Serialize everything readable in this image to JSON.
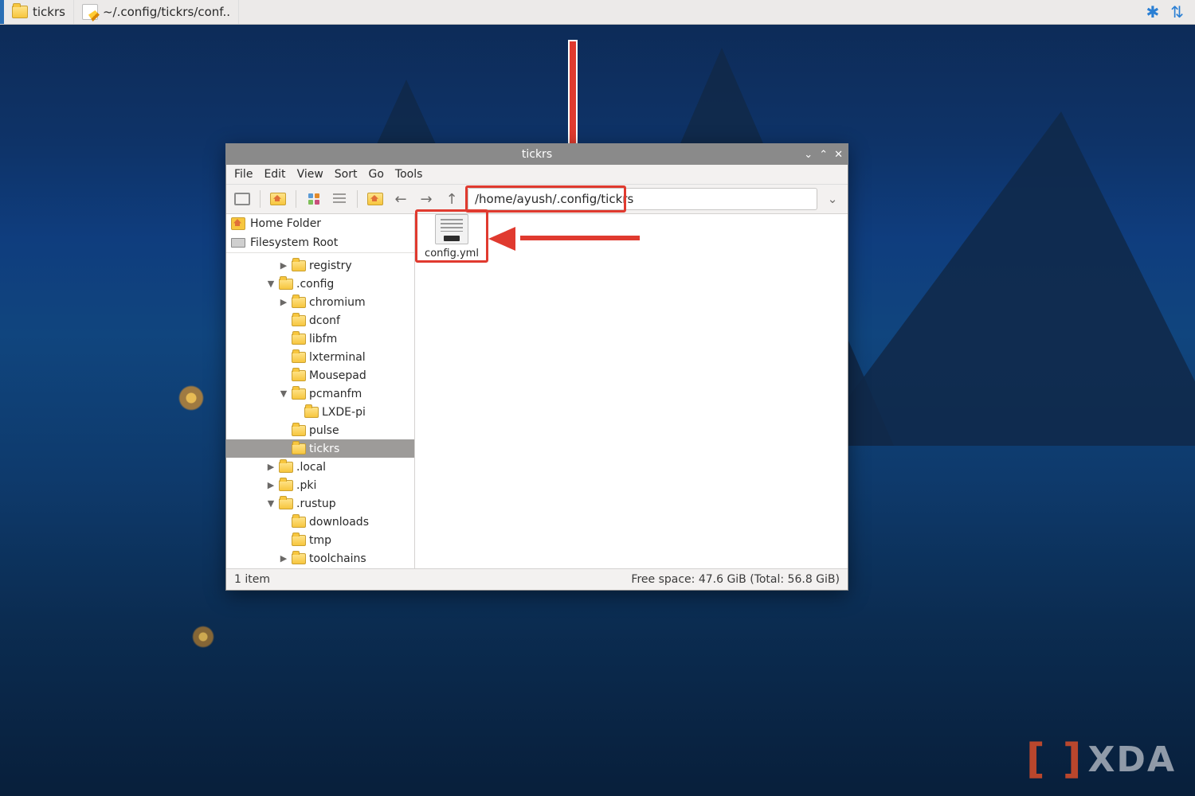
{
  "taskbar": {
    "items": [
      {
        "label": "tickrs"
      },
      {
        "label": "~/.config/tickrs/conf.."
      }
    ],
    "tray": {
      "bluetooth": "bluetooth-icon",
      "network": "network-sync-icon"
    }
  },
  "window": {
    "title": "tickrs",
    "menu": [
      "File",
      "Edit",
      "View",
      "Sort",
      "Go",
      "Tools"
    ],
    "path": "/home/ayush/.config/tickrs",
    "places": [
      {
        "label": "Home Folder"
      },
      {
        "label": "Filesystem Root"
      }
    ],
    "tree": [
      {
        "depth": 3,
        "exp": "▶",
        "label": "registry"
      },
      {
        "depth": 2,
        "exp": "▼",
        "label": ".config"
      },
      {
        "depth": 3,
        "exp": "▶",
        "label": "chromium"
      },
      {
        "depth": 3,
        "exp": "",
        "label": "dconf"
      },
      {
        "depth": 3,
        "exp": "",
        "label": "libfm"
      },
      {
        "depth": 3,
        "exp": "",
        "label": "lxterminal"
      },
      {
        "depth": 3,
        "exp": "",
        "label": "Mousepad"
      },
      {
        "depth": 3,
        "exp": "▼",
        "label": "pcmanfm"
      },
      {
        "depth": 4,
        "exp": "",
        "label": "LXDE-pi"
      },
      {
        "depth": 3,
        "exp": "",
        "label": "pulse"
      },
      {
        "depth": 3,
        "exp": "",
        "label": "tickrs",
        "selected": true
      },
      {
        "depth": 2,
        "exp": "▶",
        "label": ".local"
      },
      {
        "depth": 2,
        "exp": "▶",
        "label": ".pki"
      },
      {
        "depth": 2,
        "exp": "▼",
        "label": ".rustup"
      },
      {
        "depth": 3,
        "exp": "",
        "label": "downloads"
      },
      {
        "depth": 3,
        "exp": "",
        "label": "tmp"
      },
      {
        "depth": 3,
        "exp": "▶",
        "label": "toolchains"
      }
    ],
    "files": [
      {
        "name": "config.yml"
      }
    ],
    "status": {
      "left": "1 item",
      "right": "Free space: 47.6 GiB (Total: 56.8 GiB)"
    }
  },
  "watermark": "XDA"
}
